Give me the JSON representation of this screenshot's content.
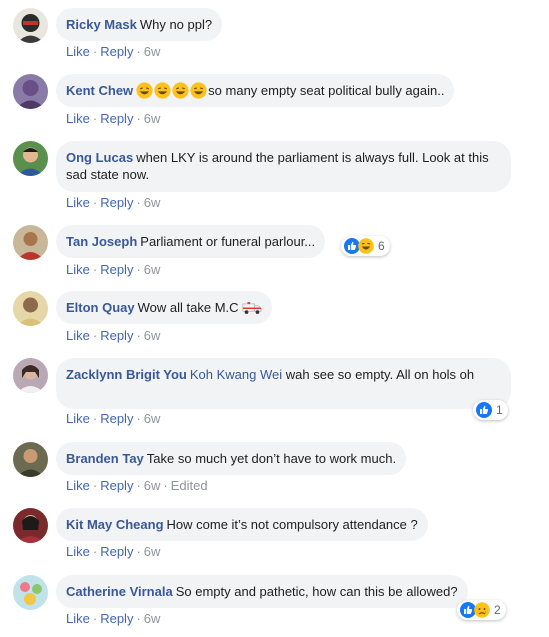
{
  "actions": {
    "like": "Like",
    "reply": "Reply",
    "edited": "Edited"
  },
  "colors": {
    "author": "#385898",
    "action": "#4267b2",
    "bubble": "#f2f3f5",
    "muted": "#90949c",
    "like_blue": "#1877f2"
  },
  "comments": [
    {
      "author": "Ricky Mask",
      "text": "Why no ppl?",
      "time": "6w"
    },
    {
      "author": "Kent Chew",
      "emojis": [
        "laughing-emoji",
        "laughing-emoji",
        "laughing-emoji",
        "laughing-emoji"
      ],
      "text": "so many empty seat political bully again..",
      "time": "6w"
    },
    {
      "author": "Ong Lucas",
      "text": "when LKY is around the parliament is always full. Look at this sad state now.",
      "time": "6w"
    },
    {
      "author": "Tan Joseph",
      "text": "Parliament or funeral parlour...",
      "time": "6w",
      "reactions": {
        "icons": [
          "like-reaction-icon",
          "haha-reaction-icon"
        ],
        "count": "6"
      }
    },
    {
      "author": "Elton Quay",
      "text": "Wow all take M.C",
      "emoji_after": "ambulance-emoji",
      "time": "6w"
    },
    {
      "author": "Zacklynn Brigit You",
      "tag": "Koh Kwang Wei",
      "text": "wah see so empty. All on hols oh",
      "time": "6w",
      "reactions": {
        "icons": [
          "like-reaction-icon"
        ],
        "count": "1"
      }
    },
    {
      "author": "Branden Tay",
      "text": "Take so much yet don’t have to work much.",
      "time": "6w",
      "edited": true
    },
    {
      "author": "Kit May Cheang",
      "text": "How come it’s not compulsory attendance ?",
      "time": "6w"
    },
    {
      "author": "Catherine Virnala",
      "text": "So empty and pathetic, how can this be allowed?",
      "time": "6w",
      "reactions": {
        "icons": [
          "like-reaction-icon",
          "sad-reaction-icon"
        ],
        "count": "2"
      }
    }
  ]
}
